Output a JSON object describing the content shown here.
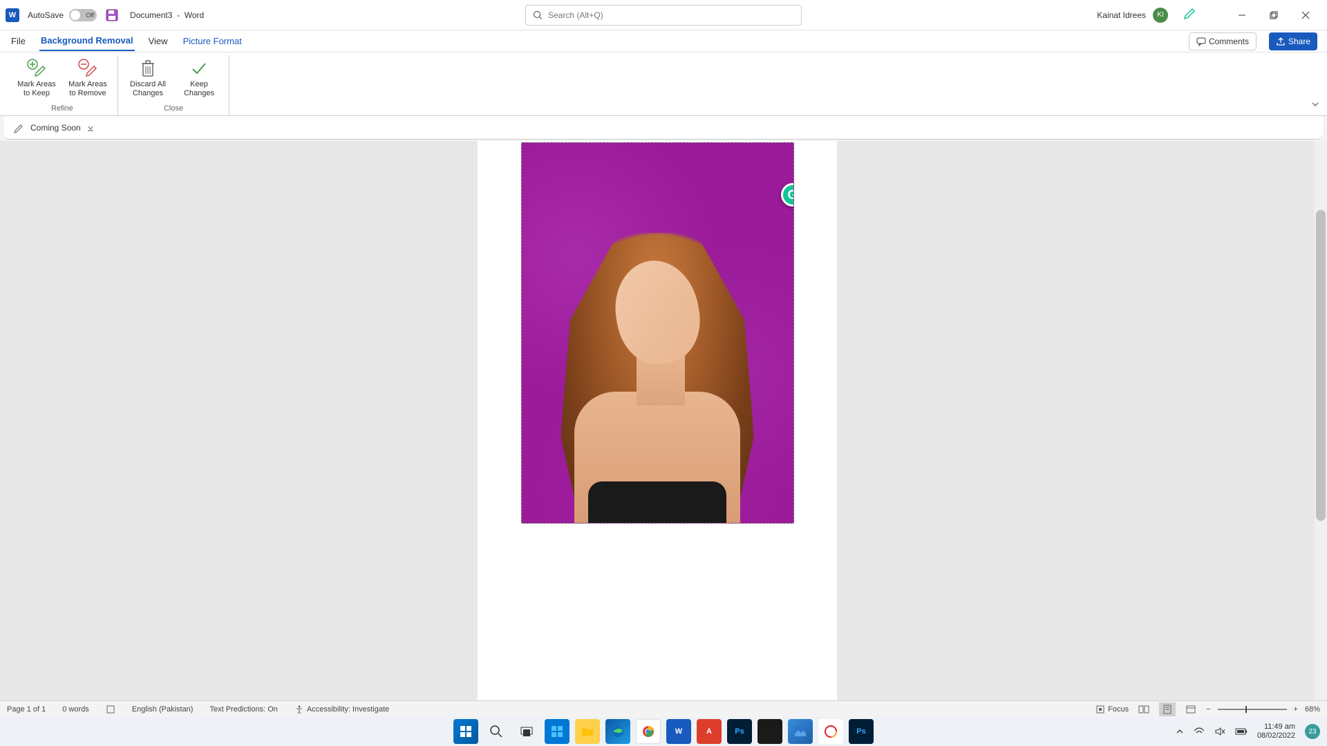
{
  "titlebar": {
    "autosave_label": "AutoSave",
    "autosave_state": "Off",
    "doc_name": "Document3",
    "doc_sep": "-",
    "app_name": "Word",
    "search_placeholder": "Search (Alt+Q)",
    "user_name": "Kainat Idrees",
    "user_initials": "KI"
  },
  "tabs": {
    "file": "File",
    "background_removal": "Background Removal",
    "view": "View",
    "picture_format": "Picture Format",
    "comments": "Comments",
    "share": "Share"
  },
  "ribbon": {
    "mark_keep": "Mark Areas\nto Keep",
    "mark_remove": "Mark Areas\nto Remove",
    "discard": "Discard All\nChanges",
    "keep": "Keep\nChanges",
    "group_refine": "Refine",
    "group_close": "Close"
  },
  "quick_access": {
    "coming_soon": "Coming Soon"
  },
  "status": {
    "page": "Page 1 of 1",
    "words": "0 words",
    "language": "English (Pakistan)",
    "predictions": "Text Predictions: On",
    "accessibility": "Accessibility: Investigate",
    "focus": "Focus",
    "zoom": "68%"
  },
  "grammarly_letter": "G",
  "taskbar": {
    "time": "11:49 am",
    "date": "08/02/2022",
    "badge": "23"
  }
}
